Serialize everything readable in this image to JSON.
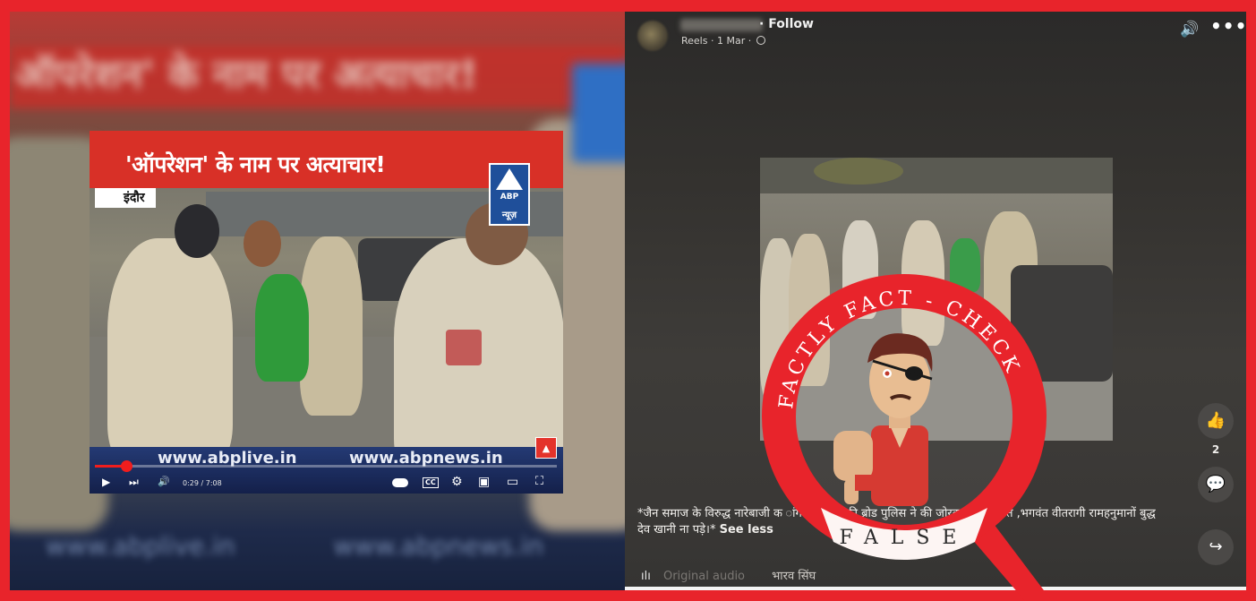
{
  "left": {
    "bg_headline": "ऑपरेशन' के नाम पर अत्याचार!",
    "bg_url_left": "www.abplive.in",
    "bg_url_right": "www.abpnews.in",
    "video": {
      "headline": "'ऑपरेशन' के नाम पर अत्याचार!",
      "city": "इंदौर",
      "channel_logo": "ABP",
      "channel_sub": "न्यूज़",
      "url_left": "www.abplive.in",
      "url_right": "www.abpnews.in",
      "time": "0:29 / 7:08",
      "progress": 0.068,
      "controls": {
        "play": "▶",
        "next": "⏭",
        "volume": "🔊",
        "captions": "CC",
        "settings": "⚙",
        "miniplayer": "▣",
        "theater": "▭",
        "fullscreen": "⛶"
      }
    }
  },
  "right": {
    "follow": "· Follow",
    "meta": "Reels · 1 Mar ·",
    "caption": "*जैन समाज के विरुद्ध नारेबाजी  क                      ांगेस के गुंडों की                   ब्रोड पुलिस ने की जोरदार पिटाई।संत ,भगवंत वीतरागी रामहनुमानों                                 बुद्ध देव               खानी ना पड़े।* ",
    "see_less": "See less",
    "audio": "Original audio",
    "audio_user": "भारव सिंघ",
    "like_count": "2",
    "icons": {
      "volume": "🔊",
      "more": "•••",
      "like": "👍",
      "comment": "💬",
      "share": "↪",
      "audio": "ılı"
    }
  },
  "stamp": {
    "arc_text": "FACTLY FACT - CHECK",
    "verdict": "FALSE",
    "ring_color": "#e8242b"
  }
}
